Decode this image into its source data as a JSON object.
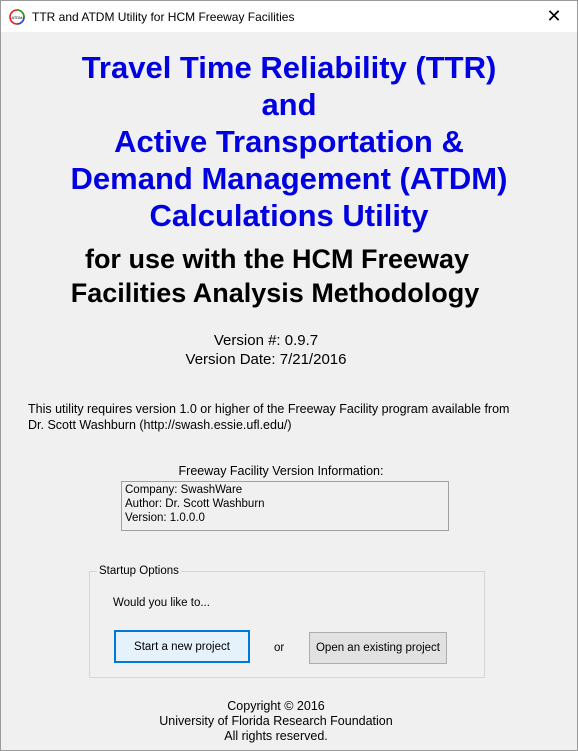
{
  "window": {
    "title": "TTR and ATDM Utility for HCM Freeway Facilities",
    "close_glyph": "✕",
    "icon_label": "ATDM"
  },
  "heading": {
    "line1": "Travel Time Reliability (TTR)",
    "line2": "and",
    "line3": "Active Transportation &",
    "line4": "Demand Management (ATDM)",
    "line5": "Calculations Utility"
  },
  "subheading": {
    "line1": "for use with the HCM Freeway",
    "line2": "Facilities Analysis Methodology"
  },
  "version": {
    "number": "Version #: 0.9.7",
    "date": "Version Date: 7/21/2016"
  },
  "requirement": {
    "line1": "This utility requires version 1.0 or higher of the Freeway Facility program available from",
    "line2": "Dr. Scott Washburn (http://swash.essie.ufl.edu/)"
  },
  "ff_info": {
    "label": "Freeway Facility Version Information:",
    "company": "Company: SwashWare",
    "author": "Author: Dr. Scott Washburn",
    "version": "Version: 1.0.0.0"
  },
  "startup": {
    "group_title": "Startup Options",
    "prompt": "Would you like to...",
    "new_project_label": "Start a new project",
    "or_label": "or",
    "open_project_label": "Open an existing project"
  },
  "footer": {
    "copyright": "Copyright © 2016",
    "org": "University of Florida Research Foundation",
    "rights": "All rights reserved."
  },
  "colors": {
    "heading_blue": "#0000e0",
    "button_focus": "#0078d7"
  }
}
